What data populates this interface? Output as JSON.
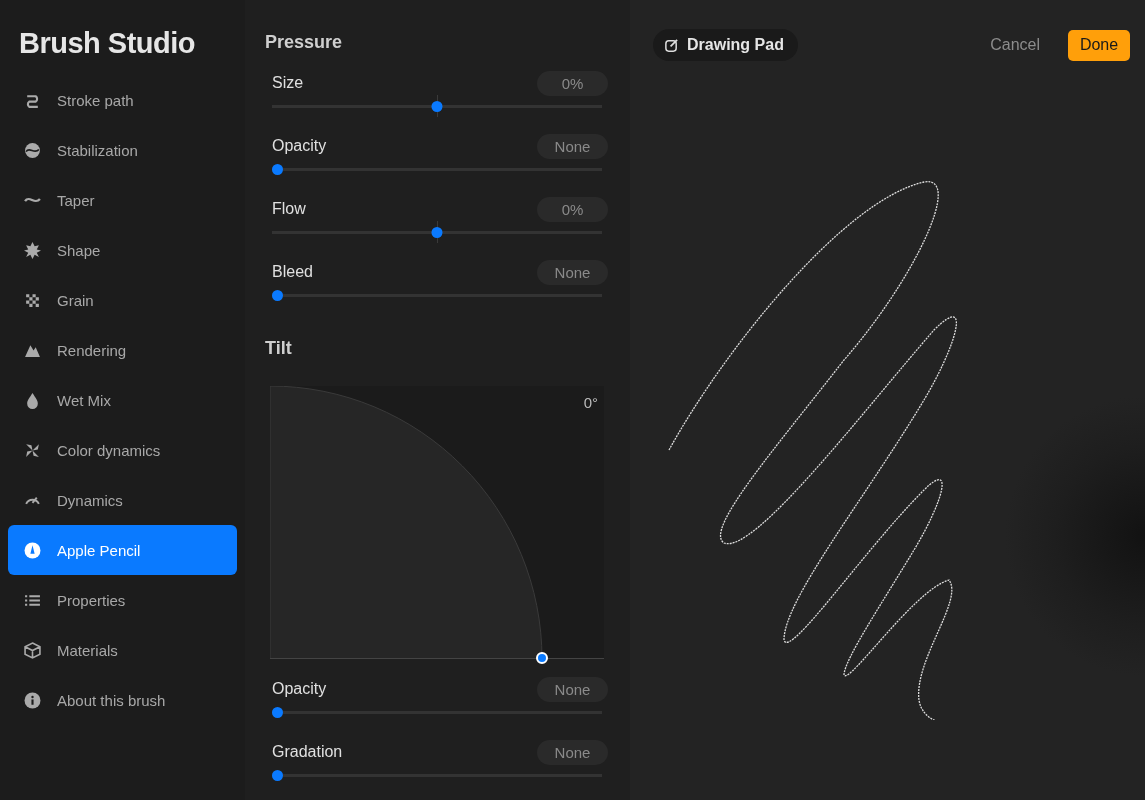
{
  "sidebar": {
    "title": "Brush Studio",
    "items": [
      {
        "label": "Stroke path",
        "selected": false
      },
      {
        "label": "Stabilization",
        "selected": false
      },
      {
        "label": "Taper",
        "selected": false
      },
      {
        "label": "Shape",
        "selected": false
      },
      {
        "label": "Grain",
        "selected": false
      },
      {
        "label": "Rendering",
        "selected": false
      },
      {
        "label": "Wet Mix",
        "selected": false
      },
      {
        "label": "Color dynamics",
        "selected": false
      },
      {
        "label": "Dynamics",
        "selected": false
      },
      {
        "label": "Apple Pencil",
        "selected": true
      },
      {
        "label": "Properties",
        "selected": false
      },
      {
        "label": "Materials",
        "selected": false
      },
      {
        "label": "About this brush",
        "selected": false
      }
    ]
  },
  "pressure": {
    "title": "Pressure",
    "sliders": [
      {
        "label": "Size",
        "value": "0%",
        "level": 0.5
      },
      {
        "label": "Opacity",
        "value": "None",
        "level": 0
      },
      {
        "label": "Flow",
        "value": "0%",
        "level": 0.5
      },
      {
        "label": "Bleed",
        "value": "None",
        "level": 0
      }
    ]
  },
  "tilt": {
    "title": "Tilt",
    "angle": "0°",
    "sliders": [
      {
        "label": "Opacity",
        "value": "None",
        "level": 0
      },
      {
        "label": "Gradation",
        "value": "None",
        "level": 0
      }
    ]
  },
  "drawing_pad": {
    "title": "Drawing Pad",
    "cancel": "Cancel",
    "done": "Done"
  }
}
